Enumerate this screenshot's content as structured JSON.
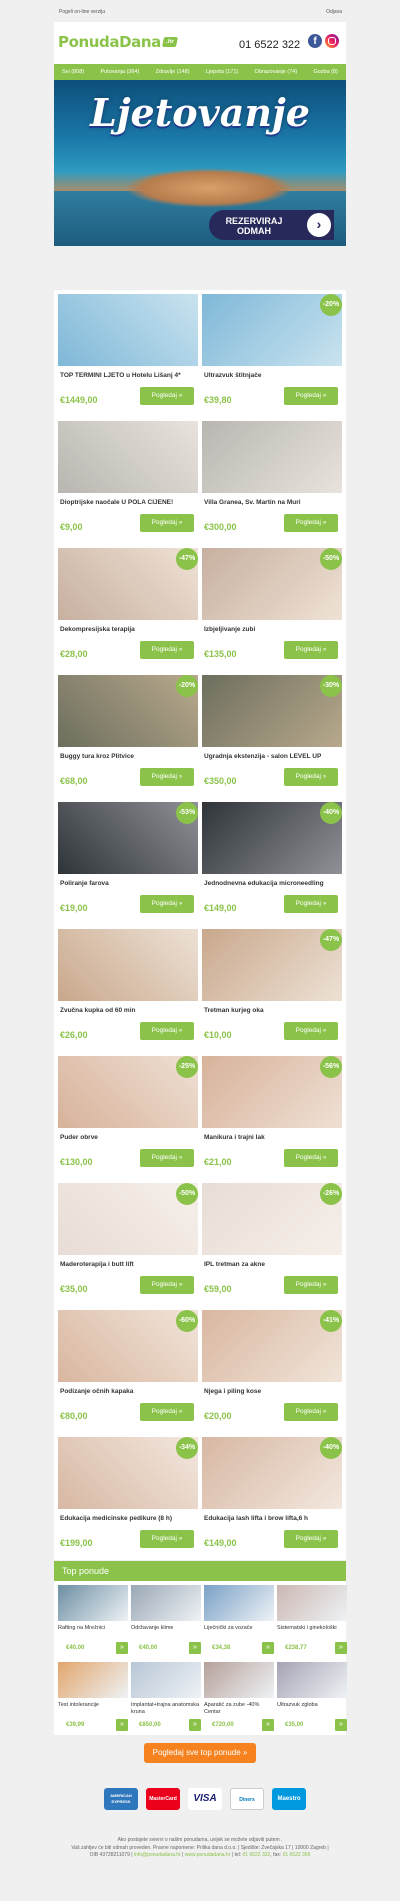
{
  "topbar": {
    "online": "Pogeli on-line verziju",
    "unsubscribe": "Odjava"
  },
  "header": {
    "logo": "PonudaDana",
    "logo_tld": ".hr",
    "phone": "01 6522 322",
    "social": [
      "facebook-icon",
      "instagram-icon"
    ]
  },
  "nav": [
    "Svi (808)",
    "Putovanja (364)",
    "Zdravlje (148)",
    "Ljepota (171)",
    "Obrazovanje (74)",
    "Gozba (8)"
  ],
  "hero": {
    "title": "Ljetovanje",
    "cta": "REZERVIRAJ ODMAH",
    "cta_icon": "chevron-right-icon"
  },
  "deals": [
    [
      {
        "name": "TOP TERMINI LJETO u Hotelu Lišanj 4*",
        "price": "€1449,00",
        "discount": "",
        "button": "Pogledaj »"
      },
      {
        "name": "Ultrazvuk štitnjače",
        "price": "€39,80",
        "discount": "-20%",
        "button": "Pogledaj »"
      }
    ],
    [
      {
        "name": "Dioptrijske naočale U POLA CIJENE!",
        "price": "€9,00",
        "discount": "",
        "button": "Pogledaj »"
      },
      {
        "name": "Villa Granea, Sv. Martin na Muri",
        "price": "€300,00",
        "discount": "",
        "button": "Pogledaj »"
      }
    ],
    [
      {
        "name": "Dekompresijska terapija",
        "price": "€28,00",
        "discount": "-47%",
        "button": "Pogledaj »"
      },
      {
        "name": "Izbjeljivanje zubi",
        "price": "€135,00",
        "discount": "-50%",
        "button": "Pogledaj »"
      }
    ],
    [
      {
        "name": "Buggy tura kroz Plitvice",
        "price": "€68,00",
        "discount": "-20%",
        "button": "Pogledaj »"
      },
      {
        "name": "Ugradnja ekstenzija - salon LEVEL UP",
        "price": "€350,00",
        "discount": "-30%",
        "button": "Pogledaj »"
      }
    ],
    [
      {
        "name": "Poliranje farova",
        "price": "€19,00",
        "discount": "-53%",
        "button": "Pogledaj »"
      },
      {
        "name": "Jednodnevna edukacija microneedling",
        "price": "€149,00",
        "discount": "-40%",
        "button": "Pogledaj »"
      }
    ],
    [
      {
        "name": "Zvučna kupka od 60 min",
        "price": "€26,00",
        "discount": "",
        "button": "Pogledaj »"
      },
      {
        "name": "Tretman kurjeg oka",
        "price": "€10,00",
        "discount": "-47%",
        "button": "Pogledaj »"
      }
    ],
    [
      {
        "name": "Puder obrve",
        "price": "€130,00",
        "discount": "-25%",
        "button": "Pogledaj »"
      },
      {
        "name": "Manikura i trajni lak",
        "price": "€21,00",
        "discount": "-56%",
        "button": "Pogledaj »"
      }
    ],
    [
      {
        "name": "Maderoterapija i butt lift",
        "price": "€35,00",
        "discount": "-50%",
        "button": "Pogledaj »"
      },
      {
        "name": "IPL tretman za akne",
        "price": "€59,00",
        "discount": "-26%",
        "button": "Pogledaj »"
      }
    ],
    [
      {
        "name": "Podizanje očnih kapaka",
        "price": "€80,00",
        "discount": "-60%",
        "button": "Pogledaj »"
      },
      {
        "name": "Njega i piling kose",
        "price": "€20,00",
        "discount": "-41%",
        "button": "Pogledaj »"
      }
    ],
    [
      {
        "name": "Edukacija medicinske pedikure (8 h)",
        "price": "€199,00",
        "discount": "-34%",
        "button": "Pogledaj »"
      },
      {
        "name": "Edukacija lash lifta i brow lifta,6 h",
        "price": "€149,00",
        "discount": "-40%",
        "button": "Pogledaj »"
      }
    ]
  ],
  "top": {
    "title": "Top ponude",
    "items": [
      {
        "name": "Rafting na Mrežnici",
        "price": "€40,00"
      },
      {
        "name": "Održavanje klime",
        "price": "€40,00"
      },
      {
        "name": "Liječnički za vozače",
        "price": "€34,38"
      },
      {
        "name": "Sistematski i ginekološki",
        "price": "€238,77"
      },
      {
        "name": "Test intolerancije",
        "price": "€39,99"
      },
      {
        "name": "Implantat+trajna anatomska kruna",
        "price": "€850,00"
      },
      {
        "name": "Aparatić za zube -40% Centar",
        "price": "€720,00"
      },
      {
        "name": "Ultrazvuk zgloba",
        "price": "€35,00"
      }
    ],
    "go": "»",
    "all_button": "Pogledaj sve top ponude »"
  },
  "cards": [
    "AMERICAN EXPRESS",
    "MasterCard",
    "VISA",
    "Diners",
    "Maestro"
  ],
  "footer": {
    "line1": "Ako postajete sviervi o našim ponudama, uvijek se možete odjaviti putem .",
    "line2": "Vaš zahtjev će biti odmah proveden. Pravne napomene: Prilika dana d.o.o. | Sjedište: Zvečajska 17 | 10000 Zagreb |",
    "line3a": "OIB 43728211079 | ",
    "email": "info@ponudadana.hr",
    "line3b": " | ",
    "web": "www.ponudadana.hr",
    "line3c": " | tel: ",
    "tel": "01 6522 322",
    "line3d": ", fax: ",
    "fax": "01 6522 366"
  },
  "colors": {
    "accent": "#8bc34a",
    "orange": "#f5821f",
    "hero_cta": "#27295a"
  }
}
